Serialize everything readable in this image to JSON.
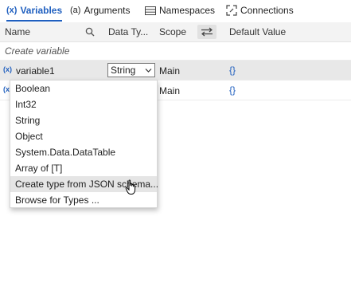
{
  "tabs": [
    {
      "label": "Variables",
      "icon": "variables-icon"
    },
    {
      "label": "Arguments",
      "icon": "arguments-icon"
    },
    {
      "label": "Namespaces",
      "icon": "namespaces-icon"
    },
    {
      "label": "Connections",
      "icon": "connections-icon"
    }
  ],
  "tab_icon_glyphs": {
    "variables": "(x)",
    "arguments": "(a)"
  },
  "columns": {
    "name": "Name",
    "data_type": "Data Ty...",
    "scope": "Scope",
    "default_value": "Default Value"
  },
  "create_variable_label": "Create variable",
  "rows": [
    {
      "icon": "(x)",
      "name": "variable1",
      "type": "String",
      "scope": "Main",
      "default": "{}"
    },
    {
      "icon": "(x)",
      "name": "",
      "type": "",
      "scope": "Main",
      "default": "{}"
    }
  ],
  "dropdown": {
    "options": [
      "Boolean",
      "Int32",
      "String",
      "Object",
      "System.Data.DataTable",
      "Array of [T]",
      "Create type from JSON schema...",
      "Browse for Types ..."
    ],
    "hovered_index": 6
  },
  "colors": {
    "accent": "#1f5fbf",
    "header_bg": "#f3f3f3",
    "selected_row_bg": "#e8e8e8",
    "hover_bg": "#e5e5e5"
  }
}
